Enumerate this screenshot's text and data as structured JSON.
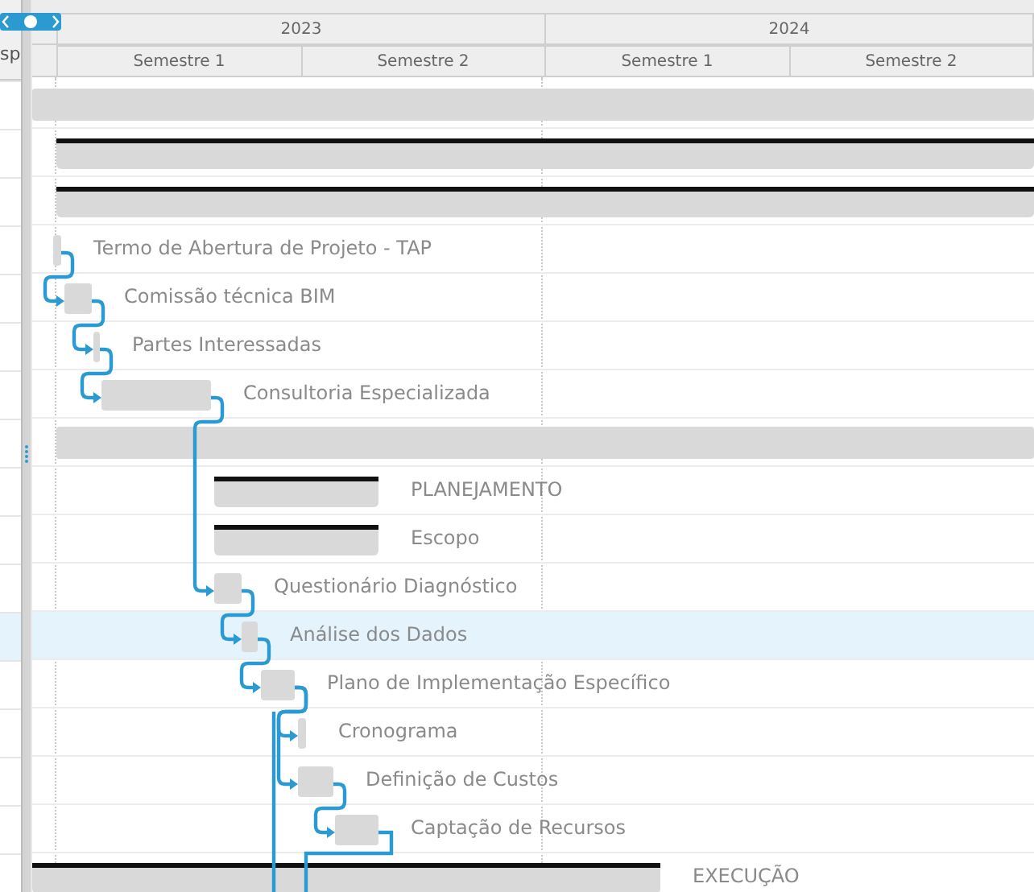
{
  "left_panel": {
    "header_partial": "sp"
  },
  "timeline": {
    "years": [
      "2023",
      "2024"
    ],
    "periods": [
      "Semestre 1",
      "Semestre 2",
      "Semestre 1",
      "Semestre 2"
    ]
  },
  "rows": [
    {
      "kind": "group",
      "selected": false
    },
    {
      "kind": "phase",
      "selected": false
    },
    {
      "kind": "phase",
      "selected": false
    },
    {
      "kind": "task",
      "label": "Termo de Abertura de Projeto - TAP",
      "selected": false
    },
    {
      "kind": "task",
      "label": "Comissão técnica BIM",
      "selected": false
    },
    {
      "kind": "task",
      "label": "Partes Interessadas",
      "selected": false
    },
    {
      "kind": "task",
      "label": "Consultoria Especializada",
      "selected": false
    },
    {
      "kind": "group",
      "selected": false
    },
    {
      "kind": "phase",
      "label": "PLANEJAMENTO",
      "selected": false
    },
    {
      "kind": "phase",
      "label": "Escopo",
      "selected": false
    },
    {
      "kind": "task",
      "label": "Questionário Diagnóstico",
      "selected": false
    },
    {
      "kind": "task",
      "label": "Análise dos Dados",
      "selected": true
    },
    {
      "kind": "task",
      "label": "Plano de Implementação Específico",
      "selected": false
    },
    {
      "kind": "task",
      "label": "Cronograma",
      "selected": false
    },
    {
      "kind": "task",
      "label": "Definição de Custos",
      "selected": false
    },
    {
      "kind": "task",
      "label": "Captação de Recursos",
      "selected": false
    },
    {
      "kind": "phase",
      "label": "EXECUÇÃO",
      "selected": false
    }
  ]
}
